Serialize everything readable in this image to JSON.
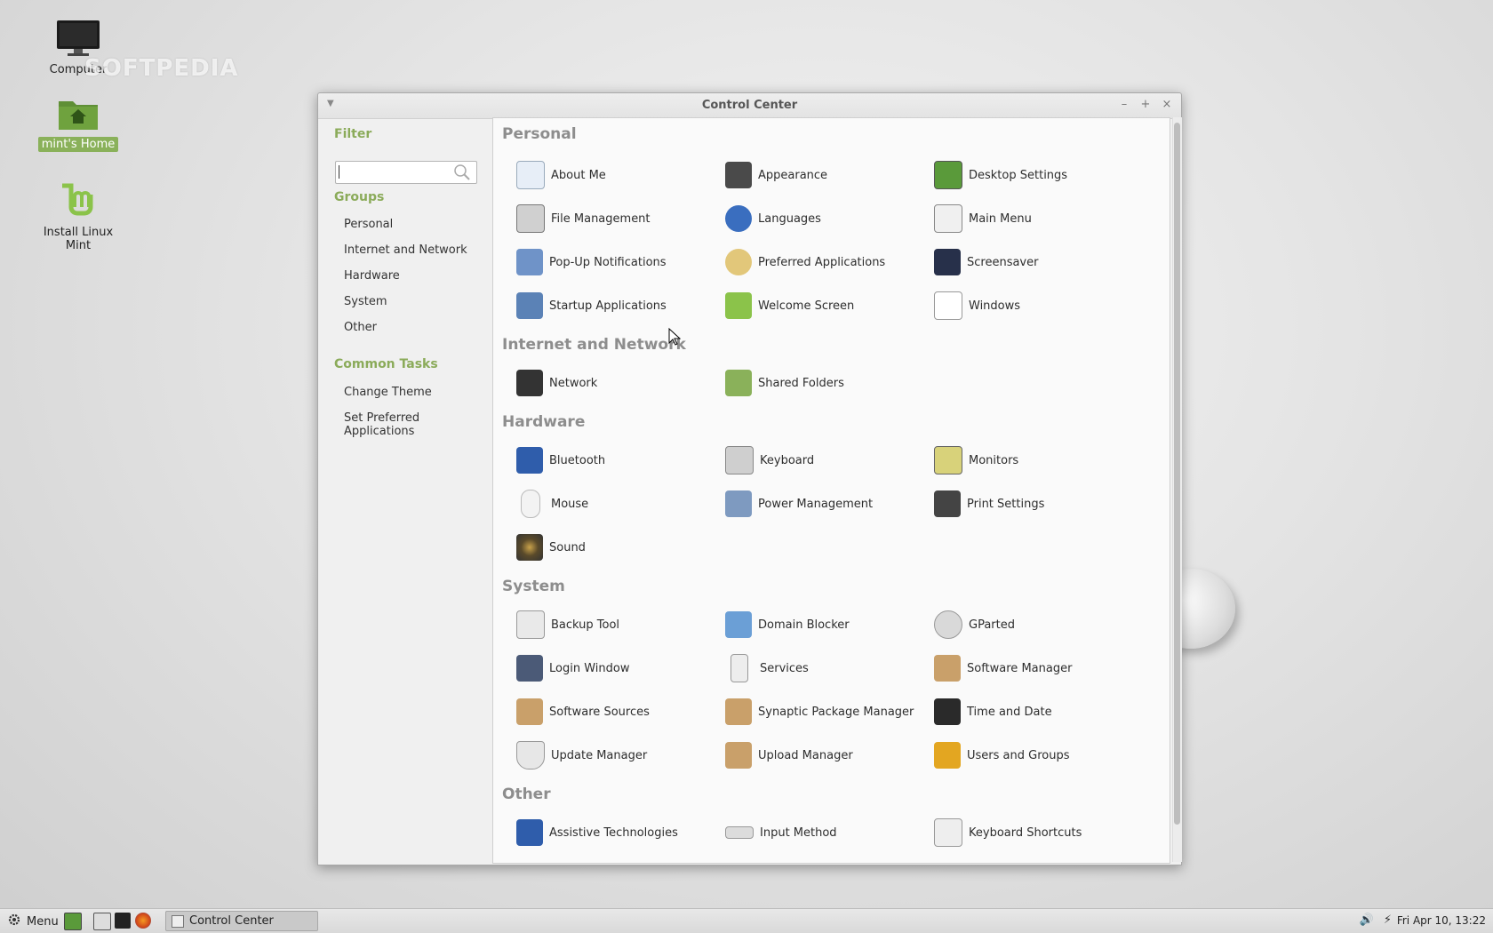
{
  "desktop": {
    "watermark": "SOFTPEDIA",
    "icons": [
      {
        "label": "Computer",
        "icon": "monitor-icon"
      },
      {
        "label": "mint's Home",
        "icon": "home-folder-icon"
      },
      {
        "label": "Install Linux Mint",
        "icon": "linux-mint-logo-icon"
      }
    ]
  },
  "window": {
    "title": "Control Center",
    "buttons": {
      "minimize": "–",
      "maximize": "+",
      "close": "×"
    },
    "sidebar": {
      "filter_heading": "Filter",
      "search_value": "",
      "groups_heading": "Groups",
      "groups": [
        "Personal",
        "Internet and Network",
        "Hardware",
        "System",
        "Other"
      ],
      "tasks_heading": "Common Tasks",
      "tasks": [
        "Change Theme",
        "Set Preferred Applications"
      ]
    },
    "categories": [
      {
        "name": "Personal",
        "items": [
          "About Me",
          "Appearance",
          "Desktop Settings",
          "File Management",
          "Languages",
          "Main Menu",
          "Pop-Up Notifications",
          "Preferred Applications",
          "Screensaver",
          "Startup Applications",
          "Welcome Screen",
          "Windows"
        ]
      },
      {
        "name": "Internet and Network",
        "items": [
          "Network",
          "Shared Folders"
        ]
      },
      {
        "name": "Hardware",
        "items": [
          "Bluetooth",
          "Keyboard",
          "Monitors",
          "Mouse",
          "Power Management",
          "Print Settings",
          "Sound"
        ]
      },
      {
        "name": "System",
        "items": [
          "Backup Tool",
          "Domain Blocker",
          "GParted",
          "Login Window",
          "Services",
          "Software Manager",
          "Software Sources",
          "Synaptic Package Manager",
          "Time and Date",
          "Update Manager",
          "Upload Manager",
          "Users and Groups"
        ]
      },
      {
        "name": "Other",
        "items": [
          "Assistive Technologies",
          "Input Method",
          "Keyboard Shortcuts"
        ]
      }
    ]
  },
  "panel": {
    "menu_label": "Menu",
    "task_label": "Control Center",
    "clock": "Fri Apr 10, 13:22"
  },
  "colors": {
    "accent": "#8bab5a",
    "category": "#8d8d8d"
  }
}
